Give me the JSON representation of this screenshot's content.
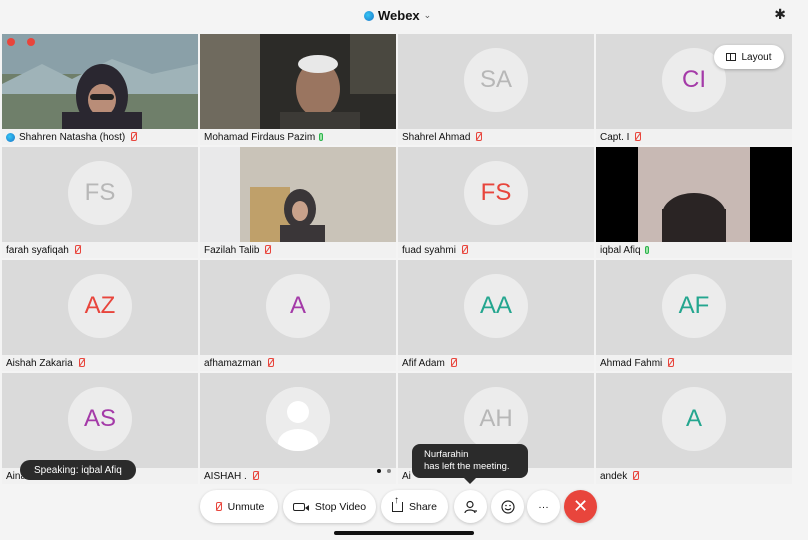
{
  "header": {
    "app_title": "Webex",
    "title_icon": "webex-logo-icon",
    "bluetooth_icon": "bluetooth-icon"
  },
  "layout_button": {
    "label": "Layout",
    "icon": "grid-layout-icon"
  },
  "participants": [
    {
      "name": "Shahren Natasha (host)",
      "initials": "",
      "mic": "muted",
      "video": true,
      "host": true
    },
    {
      "name": "Mohamad Firdaus Pazim",
      "initials": "",
      "mic": "on",
      "video": true,
      "selected": true
    },
    {
      "name": "Shahrel Ahmad",
      "initials": "SA",
      "mic": "muted",
      "initials_color": "#b7b7b7"
    },
    {
      "name": "Capt. I",
      "initials": "CI",
      "mic": "muted",
      "initials_color": "#a43aa8"
    },
    {
      "name": "farah syafiqah",
      "initials": "FS",
      "mic": "muted",
      "initials_color": "#b7b7b7"
    },
    {
      "name": "Fazilah Talib",
      "initials": "",
      "mic": "muted",
      "video": true
    },
    {
      "name": "fuad syahmi",
      "initials": "FS",
      "mic": "muted",
      "initials_color": "#e8453c"
    },
    {
      "name": "iqbal Afiq",
      "initials": "",
      "mic": "on",
      "video": true
    },
    {
      "name": "Aishah Zakaria",
      "initials": "AZ",
      "mic": "muted",
      "initials_color": "#e8453c"
    },
    {
      "name": "afhamazman",
      "initials": "A",
      "mic": "muted",
      "initials_color": "#a43aa8"
    },
    {
      "name": "Afif Adam",
      "initials": "AA",
      "mic": "muted",
      "initials_color": "#24a68f"
    },
    {
      "name": "Ahmad Fahmi",
      "initials": "AF",
      "mic": "muted",
      "initials_color": "#24a68f"
    },
    {
      "name": "Aina",
      "initials": "AS",
      "mic": "muted",
      "initials_color": "#a43aa8"
    },
    {
      "name": "AISHAH .",
      "initials": "",
      "mic": "muted",
      "placeholder_avatar": true
    },
    {
      "name": "Ai",
      "initials": "AH",
      "mic": "muted",
      "initials_color": "#b7b7b7"
    },
    {
      "name": "andek",
      "initials": "A",
      "mic": "muted",
      "initials_color": "#24a68f"
    }
  ],
  "speaking_label": "Speaking: iqbal Afiq",
  "toast": {
    "line1": "Nurfarahin",
    "line2": "has left the meeting."
  },
  "controls": {
    "unmute_label": "Unmute",
    "stop_video_label": "Stop Video",
    "share_label": "Share",
    "participants_icon": "participants-icon",
    "reactions_icon": "smiley-icon",
    "more_label": "···",
    "end_icon": "close-icon",
    "end_color": "#e8453c"
  },
  "pager": {
    "pages": 2,
    "current": 1
  }
}
